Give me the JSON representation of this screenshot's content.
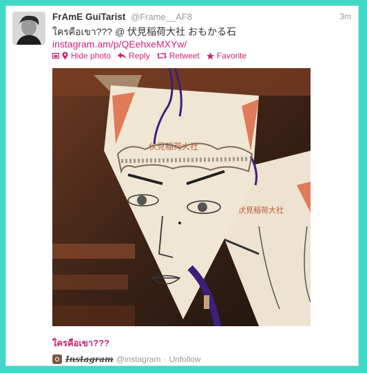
{
  "tweet": {
    "fullname": "FrAmE GuiTarist",
    "username": "@Frame__AF8",
    "time": "3m",
    "text": "ใครคือเขา??? @ 伏見稲荷大社 おもかる石",
    "link": "instagram.am/p/QEehxeMXYw/"
  },
  "actions": {
    "hide_photo": "Hide photo",
    "reply": "Reply",
    "retweet": "Retweet",
    "favorite": "Favorite"
  },
  "photo": {
    "ema_text_left": "伏見稲荷大社",
    "ema_text_right": "伏見稲荷大社"
  },
  "card": {
    "caption": "ใครคือเขา???",
    "source_name": "Instagram",
    "source_handle": "@instagram",
    "separator": "·",
    "unfollow": "Unfollow"
  },
  "colors": {
    "background": "#3fd9c8",
    "link": "#d0217a",
    "caption": "#c8246e"
  }
}
